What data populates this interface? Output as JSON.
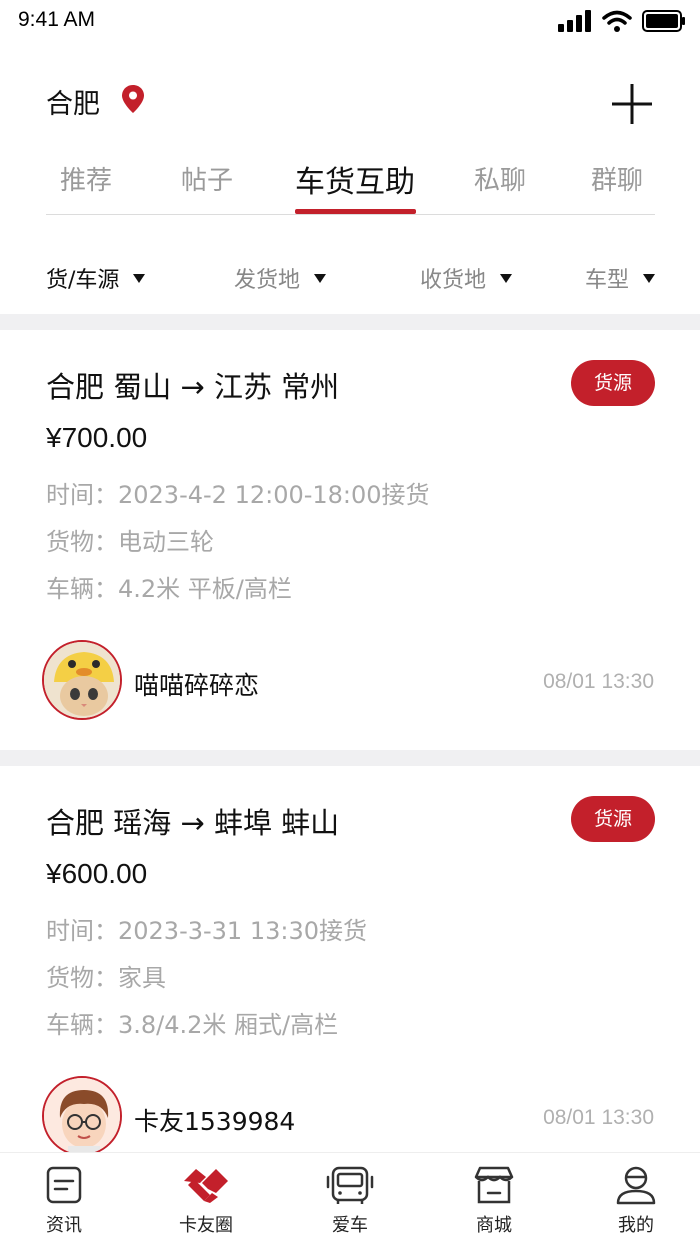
{
  "status": {
    "time": "9:41 AM"
  },
  "header": {
    "city": "合肥",
    "location_icon": "map-pin-icon",
    "add_icon": "plus-icon"
  },
  "tabs": [
    {
      "label": "推荐",
      "active": false
    },
    {
      "label": "帖子",
      "active": false
    },
    {
      "label": "车货互助",
      "active": true
    },
    {
      "label": "私聊",
      "active": false
    },
    {
      "label": "群聊",
      "active": false
    }
  ],
  "filters": [
    {
      "label": "货/车源"
    },
    {
      "label": "发货地"
    },
    {
      "label": "收货地"
    },
    {
      "label": "车型"
    }
  ],
  "posts": [
    {
      "route": "合肥 蜀山 → 江苏 常州",
      "tag": "货源",
      "price": "¥700.00",
      "time": "时间：2023-4-2 12:00-18:00接货",
      "cargo": "货物：电动三轮",
      "vehicle": "车辆：4.2米 平板/高栏",
      "user": "喵喵碎碎恋",
      "posted": "08/01 13:30"
    },
    {
      "route": "合肥 瑶海 → 蚌埠 蚌山",
      "tag": "货源",
      "price": "¥600.00",
      "time": "时间：2023-3-31 13:30接货",
      "cargo": "货物：家具",
      "vehicle": "车辆：3.8/4.2米 厢式/高栏",
      "user": "卡友1539984",
      "posted": "08/01 13:30"
    }
  ],
  "nav": [
    {
      "label": "资讯",
      "icon": "news-icon",
      "active": false
    },
    {
      "label": "卡友圈",
      "icon": "handshake-icon",
      "active": true
    },
    {
      "label": "爱车",
      "icon": "bus-icon",
      "active": false
    },
    {
      "label": "商城",
      "icon": "store-icon",
      "active": false
    },
    {
      "label": "我的",
      "icon": "profile-icon",
      "active": false
    }
  ],
  "colors": {
    "accent": "#c3202b",
    "muted_text": "#a8a8a8",
    "divider": "#f0f0f2"
  }
}
